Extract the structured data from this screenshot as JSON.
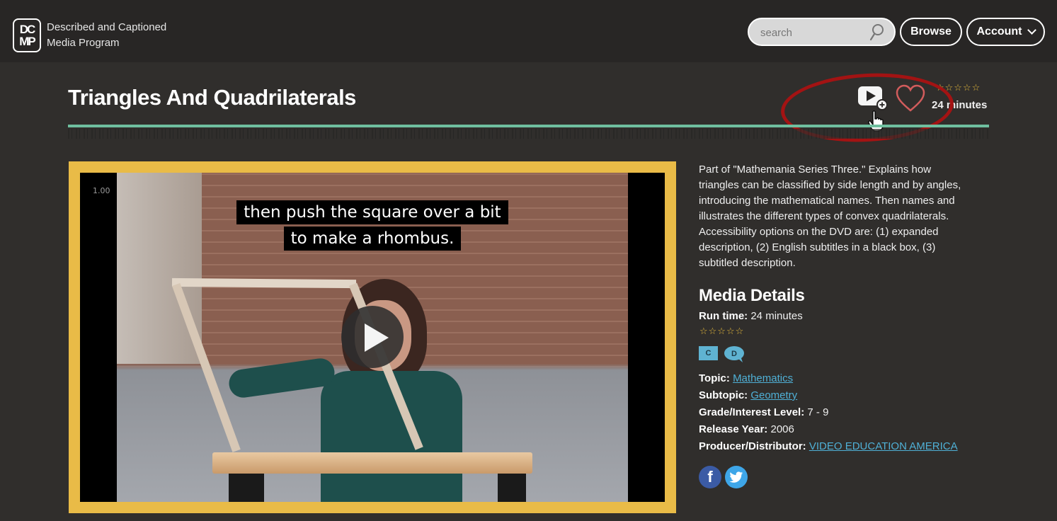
{
  "header": {
    "logo_lines": [
      "DC",
      "MP"
    ],
    "brand_line1": "Described and Captioned",
    "brand_line2": "Media Program",
    "search_placeholder": "search",
    "search_value": "",
    "browse_label": "Browse",
    "account_label": "Account"
  },
  "media": {
    "title": "Triangles And Quadrilaterals",
    "runtime_short": "24 minutes",
    "rating_stars": "☆☆☆☆☆",
    "rating_value": 0,
    "rating_max": 5,
    "actions": {
      "add_to_playlist_icon": "play-plus-icon",
      "favorite_icon": "heart-icon"
    }
  },
  "video": {
    "timecode": "1.00",
    "caption_line1": "then push the square over a bit",
    "caption_line2": "to make a rhombus.",
    "play_icon": "play-icon"
  },
  "description": "Part of \"Mathemania Series Three.\" Explains how triangles can be classified by side length and by angles, introducing the mathematical names. Then names and illustrates the different types of convex quadrilaterals. Accessibility options on the DVD are: (1) expanded description, (2) English subtitles in a black box, (3) subtitled description.",
  "details": {
    "heading": "Media Details",
    "run_time_label": "Run time:",
    "run_time_value": "24 minutes",
    "stars": "☆☆☆☆☆",
    "badges": [
      "C",
      "D"
    ],
    "topic_label": "Topic:",
    "topic_value": "Mathematics",
    "subtopic_label": "Subtopic:",
    "subtopic_value": "Geometry",
    "grade_label": "Grade/Interest Level:",
    "grade_value": "7 - 9",
    "release_label": "Release Year:",
    "release_value": "2006",
    "producer_label": "Producer/Distributor:",
    "producer_value": "VIDEO EDUCATION AMERICA"
  },
  "social": {
    "facebook_glyph": "f",
    "twitter_icon": "twitter-bird-icon"
  },
  "colors": {
    "accent_teal": "#6fbf9f",
    "video_border": "#e9bb47",
    "link_blue": "#4fb0d6",
    "star_gold": "#e4b93c",
    "annotation_red": "#a31313"
  }
}
